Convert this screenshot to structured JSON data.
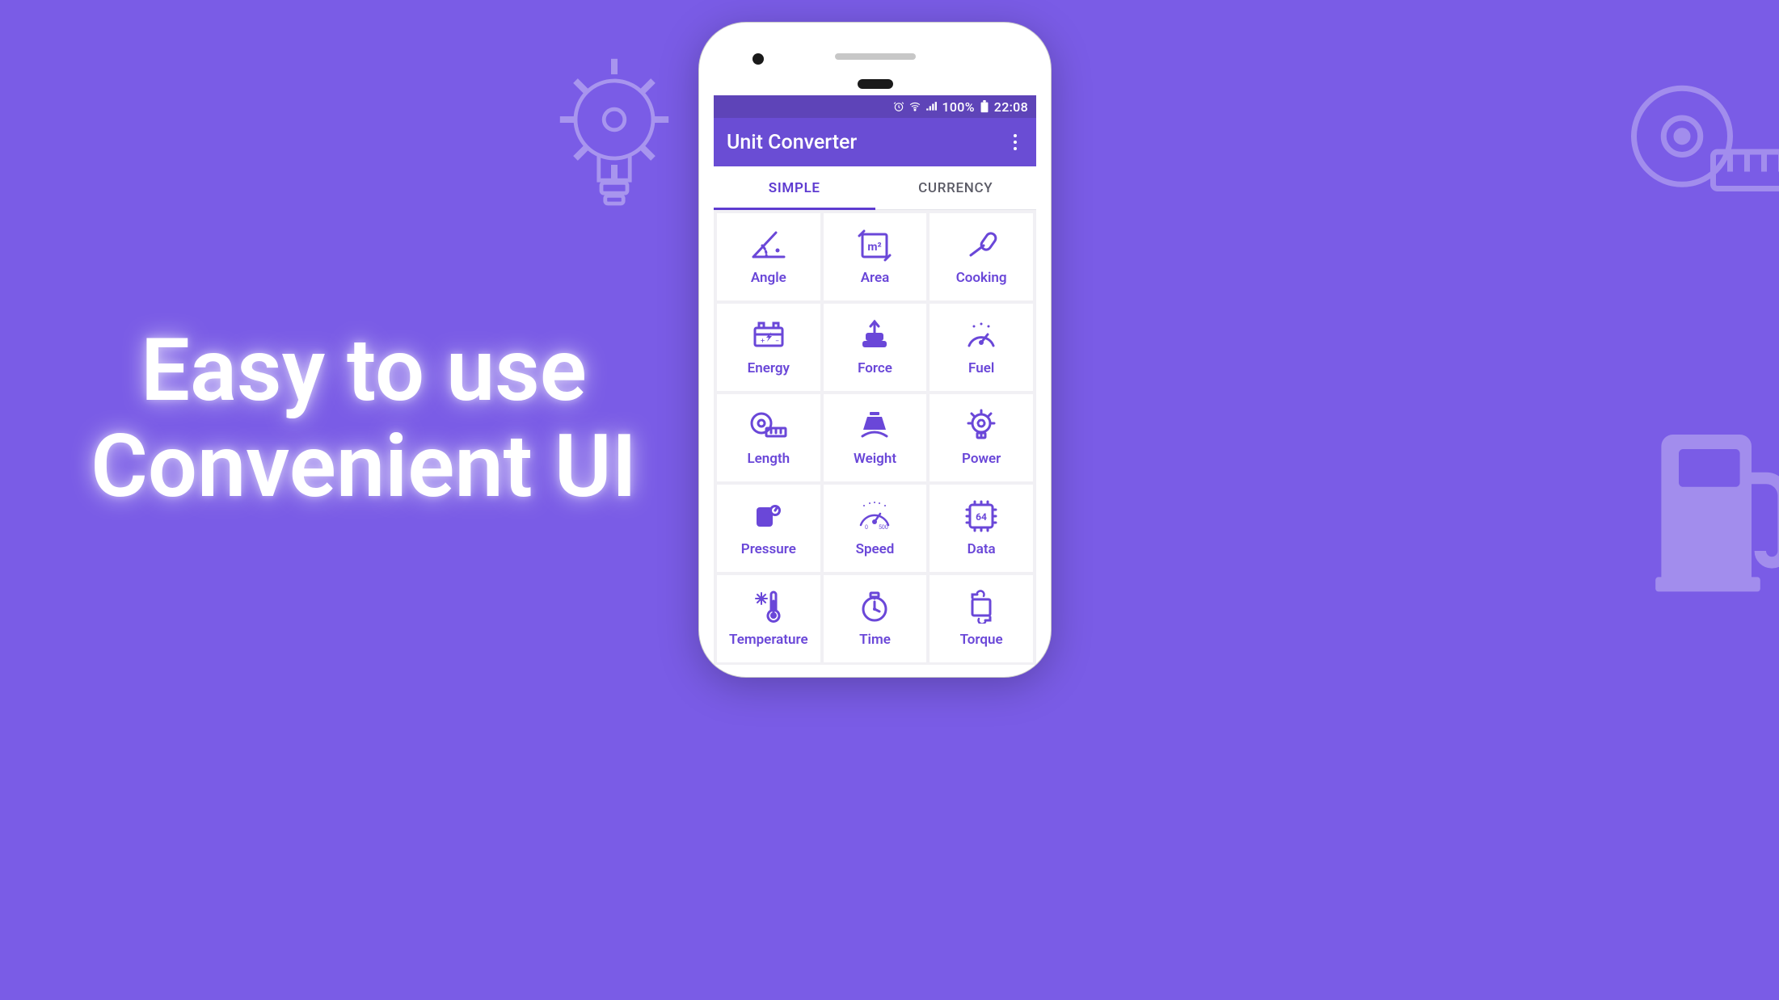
{
  "promo": {
    "line1": "Easy to use",
    "line2": "Convenient UI"
  },
  "statusbar": {
    "battery_text": "100%",
    "time": "22:08"
  },
  "app": {
    "title": "Unit Converter"
  },
  "tabs": {
    "simple": "SIMPLE",
    "currency": "CURRENCY"
  },
  "categories": [
    {
      "id": "angle",
      "label": "Angle"
    },
    {
      "id": "area",
      "label": "Area"
    },
    {
      "id": "cooking",
      "label": "Cooking"
    },
    {
      "id": "energy",
      "label": "Energy"
    },
    {
      "id": "force",
      "label": "Force"
    },
    {
      "id": "fuel",
      "label": "Fuel"
    },
    {
      "id": "length",
      "label": "Length"
    },
    {
      "id": "weight",
      "label": "Weight"
    },
    {
      "id": "power",
      "label": "Power"
    },
    {
      "id": "pressure",
      "label": "Pressure"
    },
    {
      "id": "speed",
      "label": "Speed"
    },
    {
      "id": "data",
      "label": "Data"
    },
    {
      "id": "temperature",
      "label": "Temperature"
    },
    {
      "id": "time",
      "label": "Time"
    },
    {
      "id": "torque",
      "label": "Torque"
    }
  ]
}
